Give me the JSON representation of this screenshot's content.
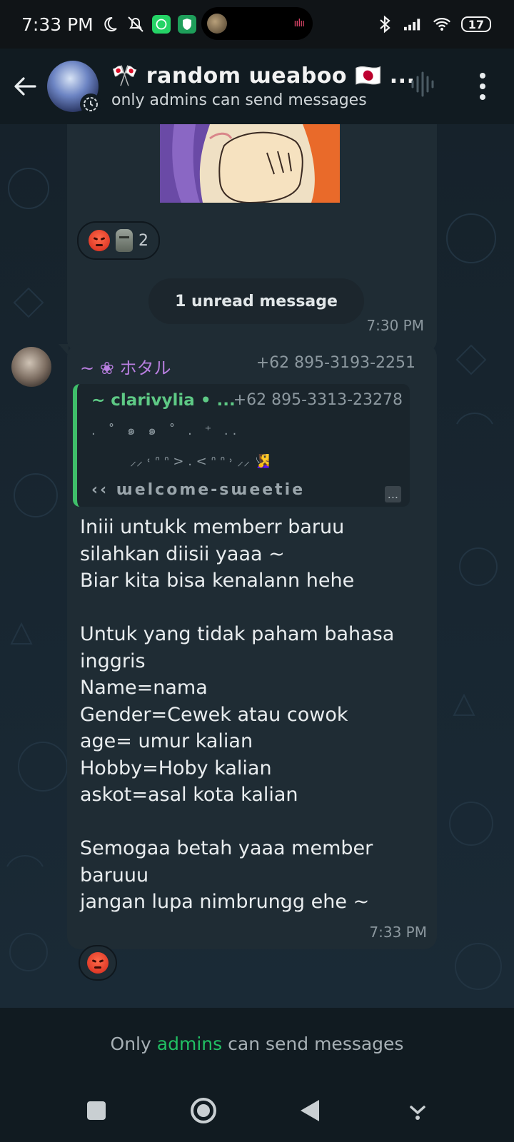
{
  "status_bar": {
    "time": "7:33 PM",
    "battery": "17",
    "icons": [
      "moon-icon",
      "mute-icon",
      "whatsapp-icon",
      "vpn-shield-icon",
      "bluetooth-icon",
      "signal-icon",
      "wifi-icon",
      "battery-icon"
    ]
  },
  "header": {
    "group_name": "🎌 random ɯeaboo 🇯🇵 ...",
    "subtitle": "only admins can send messages"
  },
  "messages": [
    {
      "type": "image",
      "time": "7:30 PM",
      "reactions": {
        "emojis": [
          "angry-face",
          "moai"
        ],
        "count": "2"
      }
    },
    {
      "type": "divider",
      "text": "1 unread message"
    },
    {
      "type": "text",
      "sender_name": "~ ❀ ホタル",
      "sender_phone": "+62 895-3193-2251",
      "quoted": {
        "name": "~ clarivylia • ...",
        "phone": "+62 895-3313-23278",
        "line1": ". ˚ ๑ ๑ ˚ . ⁺ ..",
        "line2": "⸝⸝ ˓ ᐢ ᐢ > . < ᐢ ᐢ ˒ ⸝⸝ 🧏‍♀️",
        "line3": "‹‹ ɯelcome-sɯeetie",
        "more": "..."
      },
      "lines": [
        "Iniii untukk memberr baruu",
        "silahkan diisii yaaa ~",
        "Biar kita bisa kenalann hehe",
        "",
        "Untuk yang tidak paham bahasa",
        "inggris",
        "Name=nama",
        "Gender=Cewek atau cowok",
        "age= umur kalian",
        "Hobby=Hoby kalian",
        "askot=asal kota kalian",
        "",
        "Semogaa betah yaaa member",
        "baruuu",
        "jangan lupa nimbrungg ehe ~"
      ],
      "time": "7:33 PM",
      "reactions": {
        "emojis": [
          "angry-face"
        ]
      }
    }
  ],
  "footer": {
    "prefix": "Only",
    "accent": "admins",
    "suffix": "can send messages"
  },
  "colors": {
    "accent_green": "#21c063",
    "sender_purple": "#b97fe0",
    "quote_green": "#5ec985",
    "bubble": "#1f2c34"
  }
}
